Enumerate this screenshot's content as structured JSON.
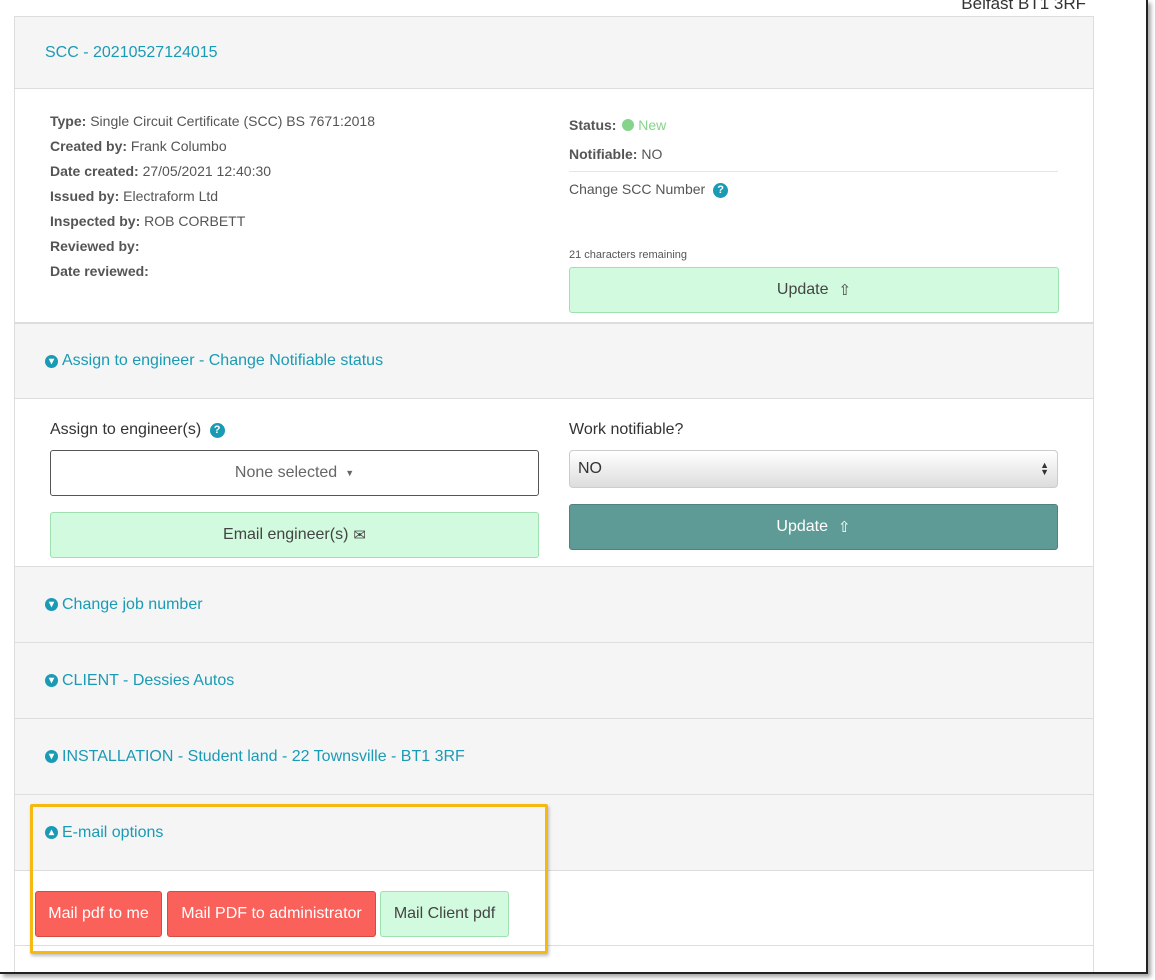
{
  "top_address": "Belfast BT1 3RF",
  "colors": {
    "accent": "#1a9bb5",
    "status_new": "#86d38c",
    "green_btn": "#d2fadf",
    "teal_btn": "#5f9b96",
    "red_btn": "#fb615b",
    "highlight": "#f6b914"
  },
  "header": {
    "title": "SCC - 20210527124015"
  },
  "details": {
    "type_label": "Type:",
    "type_value": "Single Circuit Certificate (SCC) BS 7671:2018",
    "created_by_label": "Created by:",
    "created_by_value": "Frank Columbo",
    "date_created_label": "Date created:",
    "date_created_value": "27/05/2021 12:40:30",
    "issued_by_label": "Issued by:",
    "issued_by_value": "Electraform Ltd",
    "inspected_by_label": "Inspected by:",
    "inspected_by_value": "ROB CORBETT",
    "reviewed_by_label": "Reviewed by:",
    "reviewed_by_value": "",
    "date_reviewed_label": "Date reviewed:",
    "date_reviewed_value": ""
  },
  "status": {
    "status_label": "Status:",
    "status_value": "New",
    "notifiable_label": "Notifiable:",
    "notifiable_value": "NO",
    "change_label": "Change SCC Number",
    "scc_number_value": "20210527124015",
    "chars_remaining": "21 characters remaining",
    "update_label": "Update"
  },
  "assign_section": {
    "heading": "Assign to engineer - Change Notifiable status",
    "assign_label": "Assign to engineer(s)",
    "dropdown_value": "None selected",
    "email_btn": "Email engineer(s)",
    "work_notifiable_label": "Work notifiable?",
    "notifiable_select": "NO",
    "update_label": "Update"
  },
  "sections": {
    "job_number": "Change job number",
    "client": "CLIENT - Dessies Autos",
    "installation": "INSTALLATION - Student land - 22 Townsville - BT1 3RF",
    "email_options": "E-mail options"
  },
  "email_buttons": {
    "mail_me": "Mail pdf to me",
    "mail_admin": "Mail PDF to administrator",
    "mail_client": "Mail Client pdf"
  }
}
